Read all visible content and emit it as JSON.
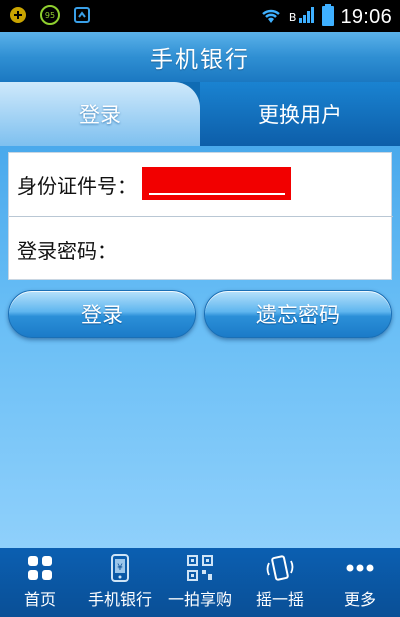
{
  "status_bar": {
    "time": "19:06",
    "network_label": "B",
    "notification_badge": "95"
  },
  "header": {
    "title": "手机银行"
  },
  "tabs": [
    {
      "label": "登录",
      "active": true
    },
    {
      "label": "更换用户",
      "active": false
    }
  ],
  "form": {
    "id_label": "身份证件号：",
    "password_label": "登录密码："
  },
  "buttons": {
    "login": "登录",
    "forgot_password": "遗忘密码"
  },
  "bottom_nav": [
    {
      "label": "首页",
      "icon": "grid-icon"
    },
    {
      "label": "手机银行",
      "icon": "phone-icon"
    },
    {
      "label": "一拍享购",
      "icon": "qr-code-icon"
    },
    {
      "label": "摇一摇",
      "icon": "shake-icon"
    },
    {
      "label": "更多",
      "icon": "more-dots-icon"
    }
  ],
  "colors": {
    "header": "#2f8fd3",
    "accent": "#1b7bc8",
    "redaction": "#f20000"
  }
}
